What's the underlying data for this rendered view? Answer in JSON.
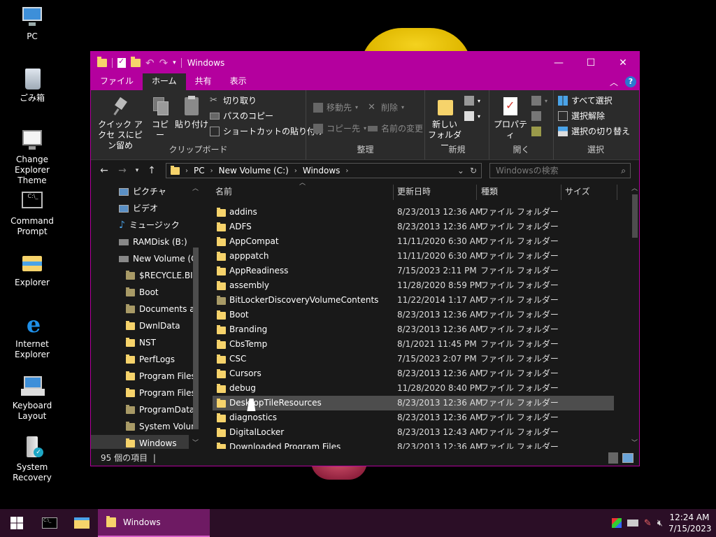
{
  "desktop": {
    "icons": [
      {
        "label": "PC",
        "icon": "pc-icon"
      },
      {
        "label": "ごみ箱",
        "icon": "recycle-bin-icon"
      },
      {
        "label": "Change Explorer Theme",
        "icon": "theme-icon"
      },
      {
        "label": "Command Prompt",
        "icon": "cmd-icon"
      },
      {
        "label": "Explorer",
        "icon": "explorer-icon"
      },
      {
        "label": "Internet Explorer",
        "icon": "ie-icon"
      },
      {
        "label": "Keyboard Layout",
        "icon": "keyboard-icon"
      },
      {
        "label": "System Recovery",
        "icon": "recovery-icon"
      }
    ]
  },
  "window": {
    "title": "Windows",
    "accent": "#b4009e",
    "tabs": {
      "file": "ファイル",
      "home": "ホーム",
      "share": "共有",
      "view": "表示"
    },
    "ribbon": {
      "clipboard": {
        "name": "クリップボード",
        "pin": "クイック アクセ スにピン留め",
        "copy": "コピー",
        "paste": "貼り付け",
        "cut": "切り取り",
        "copy_path": "パスのコピー",
        "paste_shortcut": "ショートカットの貼り付け"
      },
      "organize": {
        "name": "整理",
        "move_to": "移動先",
        "copy_to": "コピー先",
        "delete": "削除",
        "rename": "名前の変更"
      },
      "new": {
        "name": "新規",
        "new_folder": "新しい フォルダー"
      },
      "open": {
        "name": "開く",
        "properties": "プロパティ"
      },
      "select": {
        "name": "選択",
        "select_all": "すべて選択",
        "select_none": "選択解除",
        "invert": "選択の切り替え"
      }
    },
    "address": {
      "crumbs": [
        "PC",
        "New Volume (C:)",
        "Windows"
      ],
      "search_placeholder": "Windowsの検索"
    },
    "nav": [
      {
        "label": "ピクチャ",
        "type": "pictures"
      },
      {
        "label": "ビデオ",
        "type": "videos"
      },
      {
        "label": "ミュージック",
        "type": "music"
      },
      {
        "label": "RAMDisk (B:)",
        "type": "drive"
      },
      {
        "label": "New Volume (C",
        "type": "drive"
      },
      {
        "label": "$RECYCLE.BIN",
        "type": "gray"
      },
      {
        "label": "Boot",
        "type": "gray"
      },
      {
        "label": "Documents a",
        "type": "gray"
      },
      {
        "label": "DwnlData",
        "type": "folder"
      },
      {
        "label": "NST",
        "type": "folder"
      },
      {
        "label": "PerfLogs",
        "type": "folder"
      },
      {
        "label": "Program Files",
        "type": "folder"
      },
      {
        "label": "Program Files",
        "type": "folder"
      },
      {
        "label": "ProgramData",
        "type": "gray"
      },
      {
        "label": "System Volum",
        "type": "gray"
      },
      {
        "label": "Windows",
        "type": "folder"
      }
    ],
    "columns": {
      "name": "名前",
      "date": "更新日時",
      "type": "種類",
      "size": "サイズ"
    },
    "files": [
      {
        "name": "addins",
        "date": "8/23/2013 12:36 AM",
        "type": "ファイル フォルダー"
      },
      {
        "name": "ADFS",
        "date": "8/23/2013 12:36 AM",
        "type": "ファイル フォルダー"
      },
      {
        "name": "AppCompat",
        "date": "11/11/2020 6:30 AM",
        "type": "ファイル フォルダー"
      },
      {
        "name": "apppatch",
        "date": "11/11/2020 6:30 AM",
        "type": "ファイル フォルダー"
      },
      {
        "name": "AppReadiness",
        "date": "7/15/2023 2:11 PM",
        "type": "ファイル フォルダー"
      },
      {
        "name": "assembly",
        "date": "11/28/2020 8:59 PM",
        "type": "ファイル フォルダー"
      },
      {
        "name": "BitLockerDiscoveryVolumeContents",
        "date": "11/22/2014 1:17 AM",
        "type": "ファイル フォルダー"
      },
      {
        "name": "Boot",
        "date": "8/23/2013 12:36 AM",
        "type": "ファイル フォルダー"
      },
      {
        "name": "Branding",
        "date": "8/23/2013 12:36 AM",
        "type": "ファイル フォルダー"
      },
      {
        "name": "CbsTemp",
        "date": "8/1/2021 11:45 PM",
        "type": "ファイル フォルダー"
      },
      {
        "name": "CSC",
        "date": "7/15/2023 2:07 PM",
        "type": "ファイル フォルダー"
      },
      {
        "name": "Cursors",
        "date": "8/23/2013 12:36 AM",
        "type": "ファイル フォルダー"
      },
      {
        "name": "debug",
        "date": "11/28/2020 8:40 PM",
        "type": "ファイル フォルダー"
      },
      {
        "name": "DesktopTileResources",
        "date": "8/23/2013 12:36 AM",
        "type": "ファイル フォルダー"
      },
      {
        "name": "diagnostics",
        "date": "8/23/2013 12:36 AM",
        "type": "ファイル フォルダー"
      },
      {
        "name": "DigitalLocker",
        "date": "8/23/2013 12:43 AM",
        "type": "ファイル フォルダー"
      },
      {
        "name": "Downloaded Program Files",
        "date": "8/23/2013 12:36 AM",
        "type": "ファイル フォルダー"
      }
    ],
    "status": "95 個の項目"
  },
  "taskbar": {
    "active_label": "Windows",
    "time": "12:24 AM",
    "date": "7/15/2023"
  }
}
